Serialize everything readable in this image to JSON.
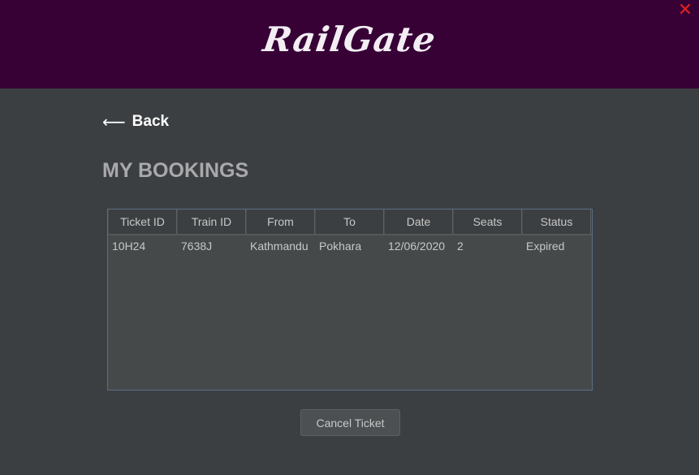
{
  "header": {
    "logo_text": "RailGate",
    "close_glyph": "✕"
  },
  "nav": {
    "back_arrow": "⟵",
    "back_label": "Back"
  },
  "page": {
    "title": "MY BOOKINGS"
  },
  "table": {
    "columns": [
      "Ticket ID",
      "Train ID",
      "From",
      "To",
      "Date",
      "Seats",
      "Status"
    ],
    "rows": [
      [
        "10H24",
        "7638J",
        "Kathmandu",
        "Pokhara",
        "12/06/2020",
        "2",
        "Expired"
      ]
    ]
  },
  "actions": {
    "cancel_label": "Cancel Ticket"
  },
  "colors": {
    "header_bg": "#370136",
    "body_bg": "#3c3f41",
    "close": "#e02020"
  }
}
